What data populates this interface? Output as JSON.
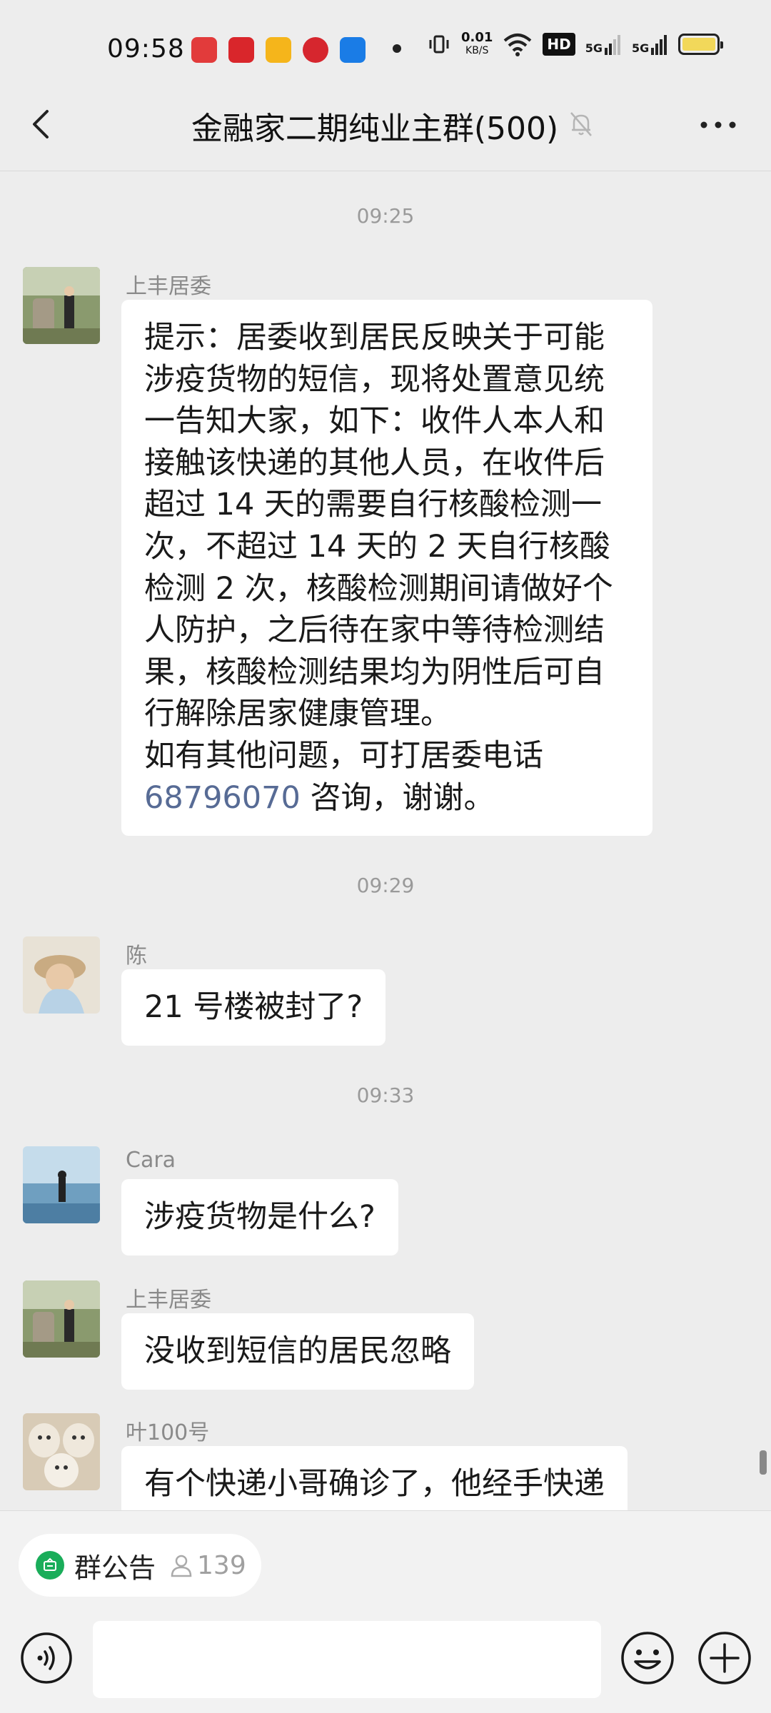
{
  "status_bar": {
    "time": "09:58",
    "net_speed_value": "0.01",
    "net_speed_unit": "KB/S",
    "hd_label": "HD",
    "signal_label_1": "5G",
    "signal_label_2": "5G"
  },
  "nav": {
    "title": "金融家二期纯业主群(500)"
  },
  "chat": {
    "timestamps": [
      "09:25",
      "09:29",
      "09:33"
    ],
    "messages": [
      {
        "sender": "上丰居委",
        "lines": [
          "提示：居委收到居民反映关于可能",
          "涉疫货物的短信，现将处置意见统",
          "一告知大家，如下：收件人本人和",
          "接触该快递的其他人员，在收件后",
          "超过 14 天的需要自行核酸检测一",
          "次，不超过 14 天的 2 天自行核酸",
          "检测 2 次，核酸检测期间请做好个",
          "人防护，之后待在家中等待检测结",
          "果，核酸检测结果均为阴性后可自",
          "行解除居家健康管理。",
          "如有其他问题，可打居委电话"
        ],
        "phone": "68796070",
        "tail": " 咨询，谢谢。"
      },
      {
        "sender": "陈",
        "text": "21 号楼被封了?"
      },
      {
        "sender": "Cara",
        "text": "涉疫货物是什么?"
      },
      {
        "sender": "上丰居委",
        "text": "没收到短信的居民忽略"
      },
      {
        "sender": "叶100号",
        "text": "有个快递小哥确诊了，他经手快递"
      }
    ]
  },
  "announcement": {
    "label": "群公告",
    "member_count": "139"
  },
  "input": {
    "placeholder": ""
  }
}
